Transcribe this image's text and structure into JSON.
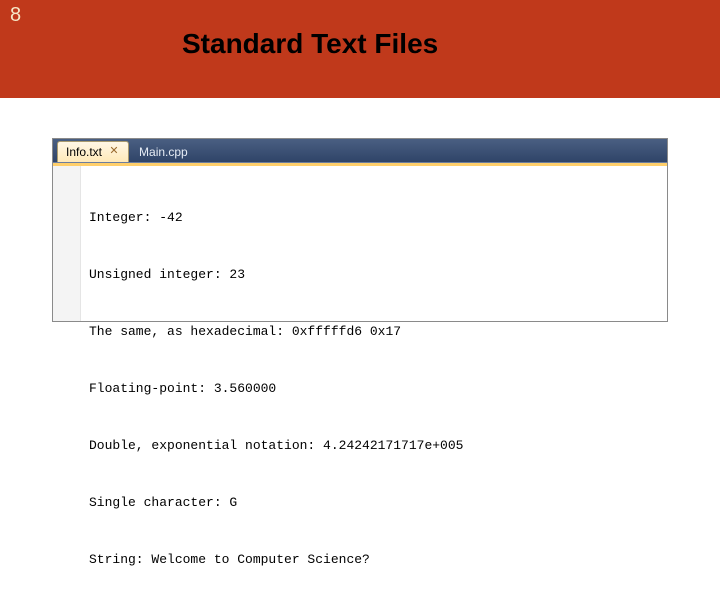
{
  "slide": {
    "number": "8",
    "title": "Standard Text Files"
  },
  "editor": {
    "tabs": [
      {
        "label": "Info.txt",
        "active": true
      },
      {
        "label": "Main.cpp",
        "active": false
      }
    ],
    "close_glyph": "✕",
    "lines": [
      "Integer: -42",
      "Unsigned integer: 23",
      "The same, as hexadecimal: 0xfffffd6 0x17",
      "Floating-point: 3.560000",
      "Double, exponential notation: 4.24242171717e+005",
      "Single character: G",
      "String: Welcome to Computer Science?"
    ]
  }
}
